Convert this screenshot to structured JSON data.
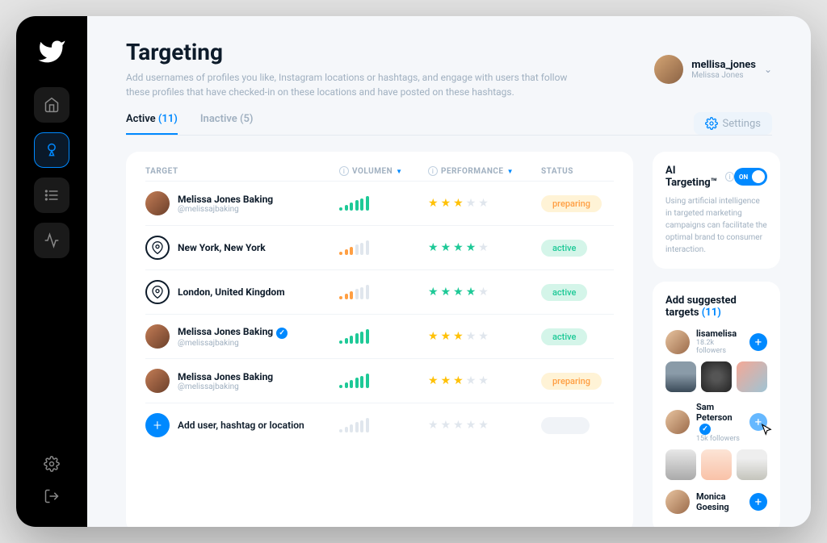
{
  "header": {
    "title": "Targeting",
    "subtitle": "Add usernames of profiles you like, Instagram locations or hashtags, and engage with users that follow these profiles that have checked-in on these locations and have posted on these hashtags."
  },
  "user": {
    "username": "mellisa_jones",
    "display_name": "Melissa Jones"
  },
  "tabs": {
    "active": {
      "label": "Active",
      "count": "(11)"
    },
    "inactive": {
      "label": "Inactive",
      "count": "(5)"
    },
    "settings_label": "Settings"
  },
  "table": {
    "columns": {
      "target": "TARGET",
      "volumen": "VOLUMEN",
      "performance": "PERFORMANCE",
      "status": "STATUS"
    },
    "rows": [
      {
        "type": "user",
        "name": "Melissa Jones Baking",
        "handle": "@melissajbaking",
        "verified": false,
        "volumen": "green-full",
        "stars_fill": 3,
        "stars_color": "yellow",
        "status": "preparing"
      },
      {
        "type": "location",
        "name": "New York, New York",
        "handle": "",
        "verified": false,
        "volumen": "orange-partial",
        "stars_fill": 4,
        "stars_color": "green",
        "status": "active"
      },
      {
        "type": "location",
        "name": "London, United Kingdom",
        "handle": "",
        "verified": false,
        "volumen": "orange-partial",
        "stars_fill": 4,
        "stars_color": "green",
        "status": "active"
      },
      {
        "type": "user",
        "name": "Melissa Jones Baking",
        "handle": "@melissajbaking",
        "verified": true,
        "volumen": "green-full",
        "stars_fill": 3,
        "stars_color": "yellow",
        "status": "active"
      },
      {
        "type": "user",
        "name": "Melissa Jones Baking",
        "handle": "@melissajbaking",
        "verified": false,
        "volumen": "green-full",
        "stars_fill": 3,
        "stars_color": "yellow",
        "status": "preparing"
      }
    ],
    "add_row": "Add user, hashtag or location"
  },
  "ai": {
    "title": "AI Targeting™",
    "toggle_label": "ON",
    "description": "Using artificial intelligence in targeted marketing campaigns can facilitate the optimal brand to consumer interaction."
  },
  "suggested": {
    "title": "Add suggested targets",
    "count": "(11)",
    "items": [
      {
        "name": "lisamelisa",
        "subtitle": "18.2k followers",
        "verified": false,
        "hover": false
      },
      {
        "name": "Sam Peterson",
        "subtitle": "15k followers",
        "verified": true,
        "hover": true
      },
      {
        "name": "Monica Goesing",
        "subtitle": "",
        "verified": false,
        "hover": false
      }
    ]
  }
}
